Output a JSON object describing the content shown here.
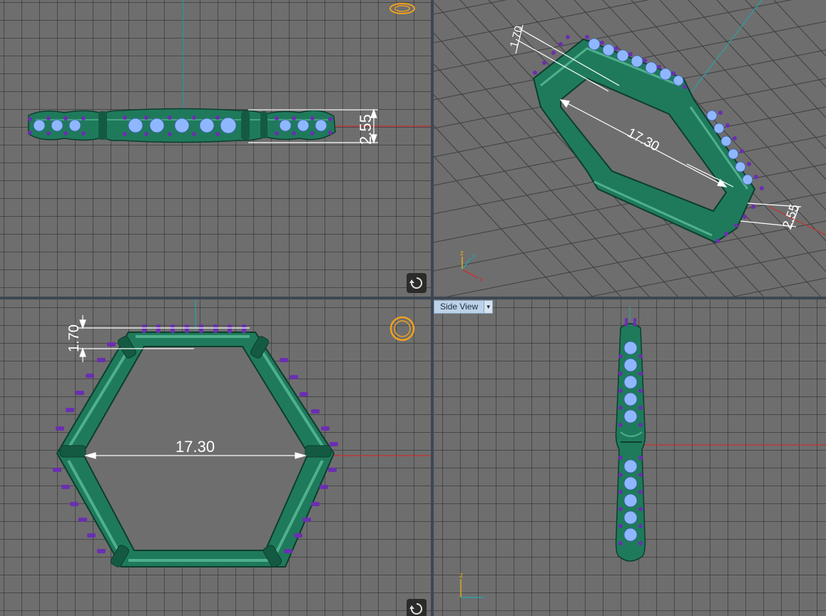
{
  "viewports": {
    "top": {
      "dimension_height": "2.55"
    },
    "perspective": {
      "dimension_width": "17.30",
      "dimension_height": "2.55",
      "dimension_thickness": "1.70",
      "axes": {
        "x": "x",
        "y": "y",
        "z": "z"
      }
    },
    "front": {
      "dimension_width": "17.30",
      "dimension_thickness": "1.70"
    },
    "side": {
      "label": "Side View",
      "axes": {
        "z": "z"
      }
    }
  },
  "colors": {
    "viewport_bg": "#6e6e6e",
    "grid_line": "#3a3a3a",
    "metal": "#1f7a5c",
    "gem": "#8fb7ff",
    "prong": "#6a2fb0",
    "axis_x": "#d43030",
    "axis_y": "#2aa0a8",
    "highlight": "#f0a020"
  }
}
